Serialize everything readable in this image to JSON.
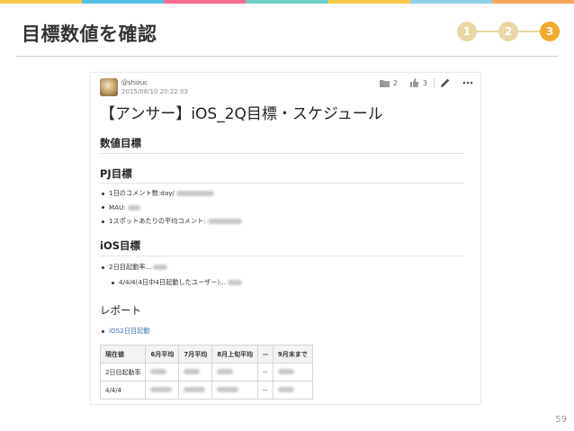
{
  "slide": {
    "title": "目標数値を確認",
    "steps": [
      "1",
      "2",
      "3"
    ],
    "active_step": 3,
    "step_inactive_color": "#e8d7a5",
    "step_active_color": "#f2a92a",
    "page_number": "59",
    "top_bar_colors": [
      "#f9c949",
      "#56c2e6",
      "#f66b8e",
      "#6ed0c8",
      "#f9c949",
      "#8fd1e8",
      "#f6a65b"
    ]
  },
  "doc": {
    "author": "@shizuc",
    "date": "2015/08/10 20:22:03",
    "meta": {
      "folder_count": "2",
      "like_count": "3"
    },
    "title": "【アンサー】iOS_2Q目標・スケジュール",
    "sections": {
      "kpi": "数値目標",
      "pj": "PJ目標",
      "ios": "iOS目標",
      "report": "レポート"
    },
    "pj_items": [
      "1日のコメント数:day/",
      "MAU:",
      "1スポットあたりの平均コメント:"
    ],
    "ios_items": [
      "2日目起動率...",
      "4/4/4(4日中4日起動したユーザー)..."
    ],
    "report_link": "iOS2日目起動",
    "table": {
      "headers": [
        "現在値",
        "6月平均",
        "7月平均",
        "8月上旬平均",
        "--",
        "9月末まで"
      ],
      "rows": [
        [
          "2日目起動率",
          "",
          "",
          "",
          "--",
          ""
        ],
        [
          "4/4/4",
          "",
          "",
          "",
          "--",
          ""
        ]
      ]
    }
  }
}
